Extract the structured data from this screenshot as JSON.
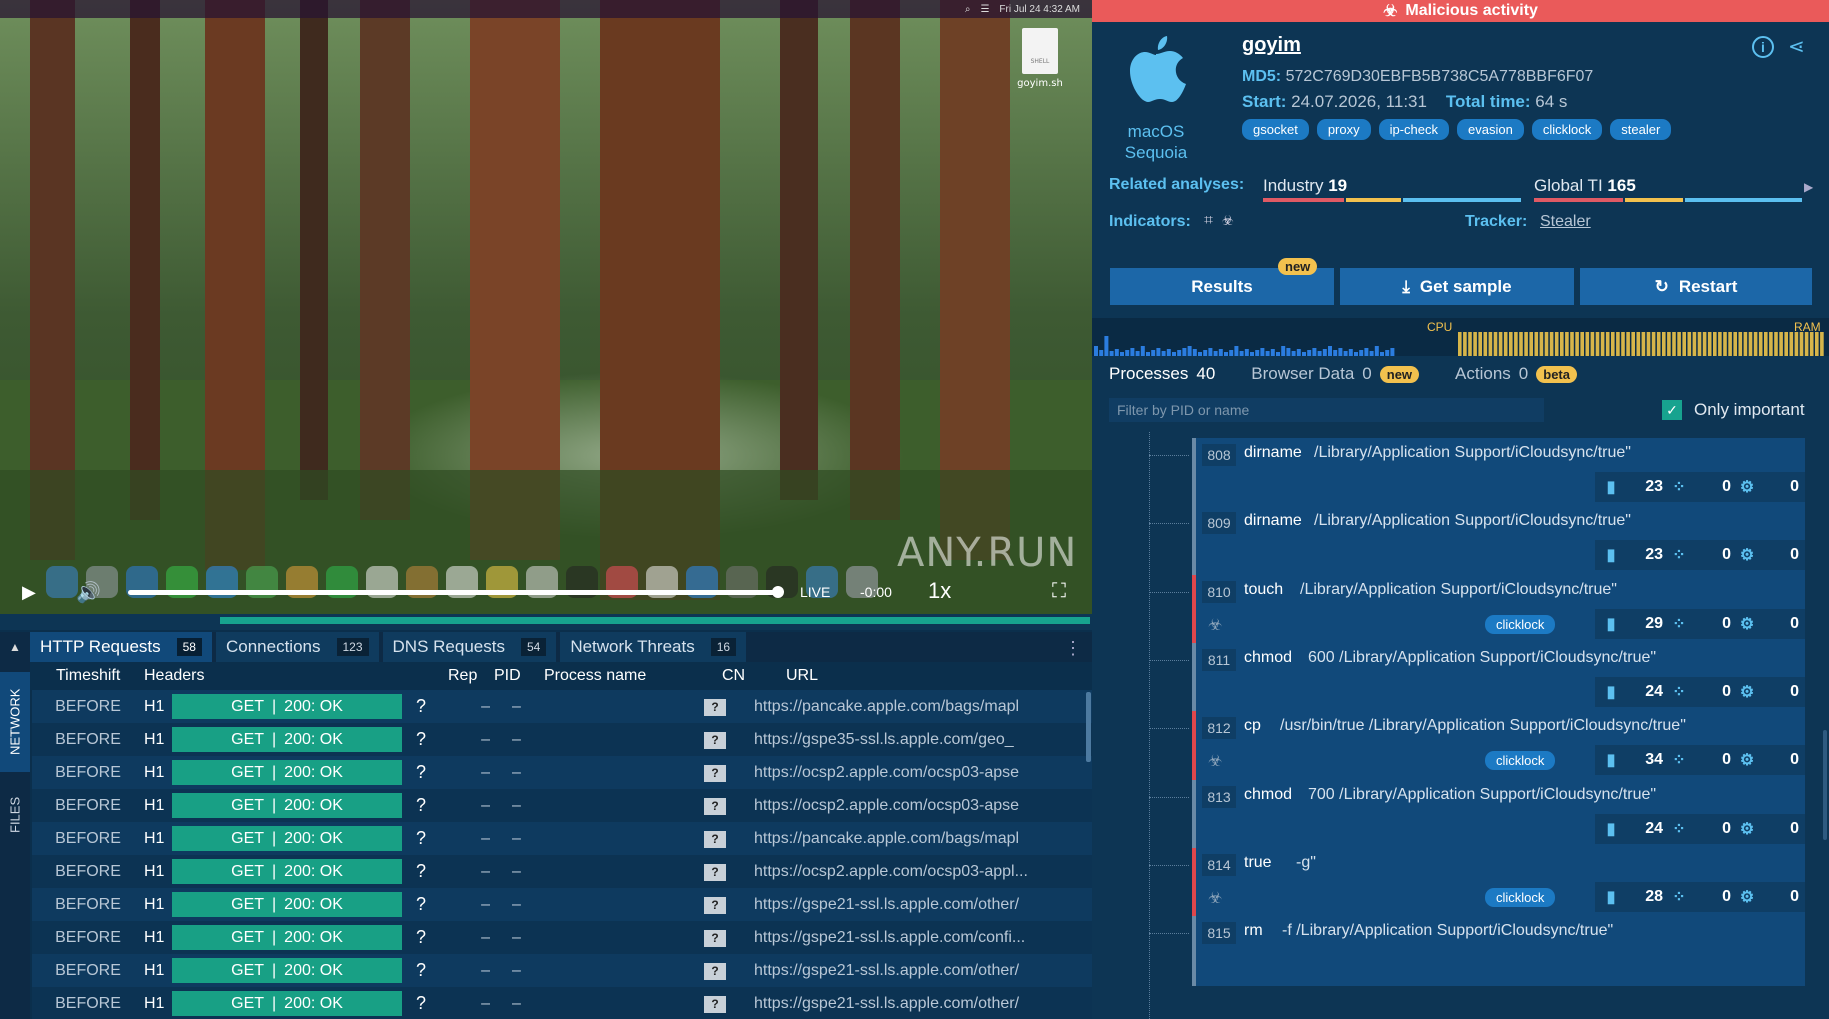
{
  "vm": {
    "menubar_clock": "Fri Jul 24  4:32 AM",
    "desktop_file": "goyim.sh",
    "desktop_file_type": "SHELL",
    "watermark": "ANY.RUN"
  },
  "player": {
    "live": "LIVE",
    "time": "-0:00",
    "speed": "1x"
  },
  "net_tabs": [
    {
      "label": "HTTP Requests",
      "count": "58"
    },
    {
      "label": "Connections",
      "count": "123"
    },
    {
      "label": "DNS Requests",
      "count": "54"
    },
    {
      "label": "Network Threats",
      "count": "16"
    }
  ],
  "side_tabs": {
    "network": "NETWORK",
    "files": "FILES"
  },
  "http_table": {
    "headers": {
      "timeshift": "Timeshift",
      "headers": "Headers",
      "rep": "Rep",
      "pid": "PID",
      "process": "Process name",
      "cn": "CN",
      "url": "URL"
    },
    "rows": [
      {
        "ts": "BEFORE",
        "h": "H1",
        "method": "GET",
        "status": "200: OK",
        "rep": "?",
        "pid": "–",
        "proc": "–",
        "cn": "?",
        "url": "https://pancake.apple.com/bags/mapl"
      },
      {
        "ts": "BEFORE",
        "h": "H1",
        "method": "GET",
        "status": "200: OK",
        "rep": "?",
        "pid": "–",
        "proc": "–",
        "cn": "?",
        "url": "https://gspe35-ssl.ls.apple.com/geo_"
      },
      {
        "ts": "BEFORE",
        "h": "H1",
        "method": "GET",
        "status": "200: OK",
        "rep": "?",
        "pid": "–",
        "proc": "–",
        "cn": "?",
        "url": "https://ocsp2.apple.com/ocsp03-apse"
      },
      {
        "ts": "BEFORE",
        "h": "H1",
        "method": "GET",
        "status": "200: OK",
        "rep": "?",
        "pid": "–",
        "proc": "–",
        "cn": "?",
        "url": "https://ocsp2.apple.com/ocsp03-apse"
      },
      {
        "ts": "BEFORE",
        "h": "H1",
        "method": "GET",
        "status": "200: OK",
        "rep": "?",
        "pid": "–",
        "proc": "–",
        "cn": "?",
        "url": "https://pancake.apple.com/bags/mapl"
      },
      {
        "ts": "BEFORE",
        "h": "H1",
        "method": "GET",
        "status": "200: OK",
        "rep": "?",
        "pid": "–",
        "proc": "–",
        "cn": "?",
        "url": "https://ocsp2.apple.com/ocsp03-appl..."
      },
      {
        "ts": "BEFORE",
        "h": "H1",
        "method": "GET",
        "status": "200: OK",
        "rep": "?",
        "pid": "–",
        "proc": "–",
        "cn": "?",
        "url": "https://gspe21-ssl.ls.apple.com/other/"
      },
      {
        "ts": "BEFORE",
        "h": "H1",
        "method": "GET",
        "status": "200: OK",
        "rep": "?",
        "pid": "–",
        "proc": "–",
        "cn": "?",
        "url": "https://gspe21-ssl.ls.apple.com/confi..."
      },
      {
        "ts": "BEFORE",
        "h": "H1",
        "method": "GET",
        "status": "200: OK",
        "rep": "?",
        "pid": "–",
        "proc": "–",
        "cn": "?",
        "url": "https://gspe21-ssl.ls.apple.com/other/"
      },
      {
        "ts": "BEFORE",
        "h": "H1",
        "method": "GET",
        "status": "200: OK",
        "rep": "?",
        "pid": "–",
        "proc": "–",
        "cn": "?",
        "url": "https://gspe21-ssl.ls.apple.com/other/"
      }
    ]
  },
  "alert": {
    "label": "Malicious activity",
    "color": "#ea5a5a"
  },
  "os": {
    "name": "macOS",
    "version": "Sequoia"
  },
  "sample": {
    "title": "goyim",
    "md5_label": "MD5:",
    "md5": "572C769D30EBFB5B738C5A778BBF6F07",
    "start_label": "Start:",
    "start": "24.07.2026, 11:31",
    "total_label": "Total time:",
    "total": "64 s",
    "tags": [
      "gsocket",
      "proxy",
      "ip-check",
      "evasion",
      "clicklock",
      "stealer"
    ]
  },
  "related": {
    "label": "Related analyses:",
    "industry_label": "Industry",
    "industry": "19",
    "global_label": "Global TI",
    "global": "165"
  },
  "indicators": {
    "label": "Indicators:"
  },
  "tracker": {
    "label": "Tracker:",
    "value": "Stealer"
  },
  "buttons": {
    "results": "Results",
    "results_badge": "new",
    "sample": "Get sample",
    "restart": "Restart"
  },
  "monitor": {
    "cpu": "CPU",
    "ram": "RAM"
  },
  "process_tabs": [
    {
      "label": "Processes",
      "count": "40"
    },
    {
      "label": "Browser Data",
      "count": "0",
      "badge": "new"
    },
    {
      "label": "Actions",
      "count": "0",
      "badge": "beta"
    }
  ],
  "filter": {
    "placeholder": "Filter by PID or name",
    "only_important": "Only important"
  },
  "processes": [
    {
      "pid": "808",
      "name": "dirname",
      "cmd": "/Library/Application Support/iCloudsync/true\"",
      "files": "23",
      "modules": "0",
      "settings": "0",
      "malicious": false
    },
    {
      "pid": "809",
      "name": "dirname",
      "cmd": "/Library/Application Support/iCloudsync/true\"",
      "files": "23",
      "modules": "0",
      "settings": "0",
      "malicious": false
    },
    {
      "pid": "810",
      "name": "touch",
      "cmd": "/Library/Application Support/iCloudsync/true\"",
      "files": "29",
      "modules": "0",
      "settings": "0",
      "malicious": true,
      "tag": "clicklock"
    },
    {
      "pid": "811",
      "name": "chmod",
      "cmd": "600 /Library/Application Support/iCloudsync/true\"",
      "files": "24",
      "modules": "0",
      "settings": "0",
      "malicious": false
    },
    {
      "pid": "812",
      "name": "cp",
      "cmd": "/usr/bin/true /Library/Application Support/iCloudsync/true\"",
      "files": "34",
      "modules": "0",
      "settings": "0",
      "malicious": true,
      "tag": "clicklock"
    },
    {
      "pid": "813",
      "name": "chmod",
      "cmd": "700 /Library/Application Support/iCloudsync/true\"",
      "files": "24",
      "modules": "0",
      "settings": "0",
      "malicious": false
    },
    {
      "pid": "814",
      "name": "true",
      "cmd": "-g\"",
      "files": "28",
      "modules": "0",
      "settings": "0",
      "malicious": true,
      "tag": "clicklock"
    },
    {
      "pid": "815",
      "name": "rm",
      "cmd": "-f /Library/Application Support/iCloudsync/true\"",
      "files": "",
      "modules": "",
      "settings": "",
      "malicious": false
    }
  ]
}
